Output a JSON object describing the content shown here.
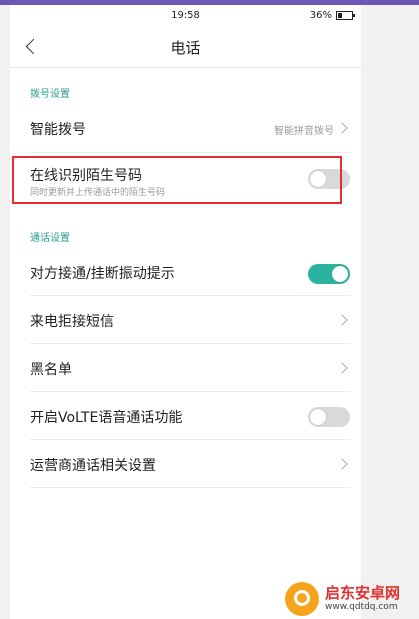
{
  "status_bar": {
    "signal": "",
    "time": "19:58",
    "battery_percent": "36%"
  },
  "header": {
    "title": "电话"
  },
  "dial_section": {
    "title": "拨号设置",
    "smart_dial": {
      "label": "智能拨号",
      "value": "智能拼音拨号"
    },
    "online_identify": {
      "label": "在线识别陌生号码",
      "subtitle": "同时更新并上传通话中的陌生号码",
      "enabled": false
    }
  },
  "call_section": {
    "title": "通话设置",
    "vibrate_on_connect": {
      "label": "对方接通/挂断振动提示",
      "enabled": true
    },
    "reject_sms": {
      "label": "来电拒接短信"
    },
    "blacklist": {
      "label": "黑名单"
    },
    "volte": {
      "label": "开启VoLTE语音通话功能",
      "enabled": false
    },
    "carrier_settings": {
      "label": "运营商通话相关设置"
    }
  },
  "watermark": {
    "name": "启东安卓网",
    "url": "www.qdtdq.com"
  },
  "colors": {
    "accent": "#2bb3a0",
    "highlight": "#e52d2d",
    "top_stripe": "#6a58b4"
  }
}
